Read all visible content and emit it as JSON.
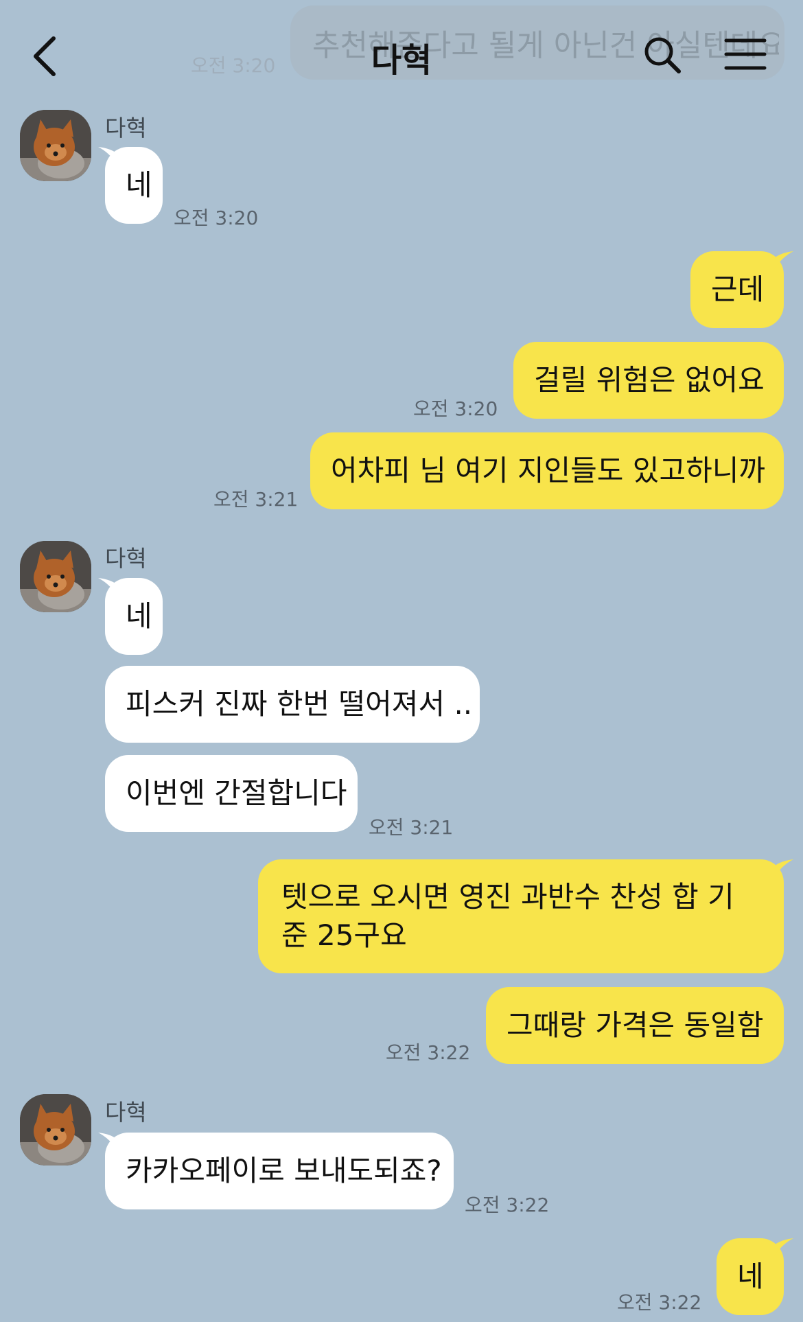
{
  "colors": {
    "background": "#abc0d1",
    "incoming_bubble": "#ffffff",
    "outgoing_bubble": "#f8e44b"
  },
  "header": {
    "title": "다혁",
    "back_icon": "chevron-left-icon",
    "search_icon": "search-icon",
    "menu_icon": "hamburger-menu-icon",
    "ghost_preview_text": "추천해준다고 될게 아닌건 아실텐데요",
    "ghost_preview_time": "오전 3:20"
  },
  "messages": [
    {
      "direction": "in",
      "sender": "다혁",
      "text": "네",
      "time": "오전 3:20"
    },
    {
      "direction": "out",
      "text": "근데",
      "time": ""
    },
    {
      "direction": "out",
      "text": "걸릴 위험은 없어요",
      "time": "오전 3:20"
    },
    {
      "direction": "out",
      "text": "어차피 님 여기 지인들도 있고하니까",
      "time": "오전 3:21"
    },
    {
      "direction": "in",
      "sender": "다혁",
      "text": "네",
      "time": ""
    },
    {
      "direction": "in",
      "text": "피스커 진짜 한번 떨어져서 ..",
      "time": ""
    },
    {
      "direction": "in",
      "text": "이번엔 간절합니다",
      "time": "오전 3:21"
    },
    {
      "direction": "out",
      "text": "텟으로 오시면 영진 과반수 찬성 합 기준 25구요",
      "time": ""
    },
    {
      "direction": "out",
      "text": "그때랑 가격은 동일함",
      "time": "오전 3:22"
    },
    {
      "direction": "in",
      "sender": "다혁",
      "text": "카카오페이로 보내도되죠?",
      "time": "오전 3:22"
    },
    {
      "direction": "out",
      "text": "네",
      "time": "오전 3:22"
    }
  ]
}
